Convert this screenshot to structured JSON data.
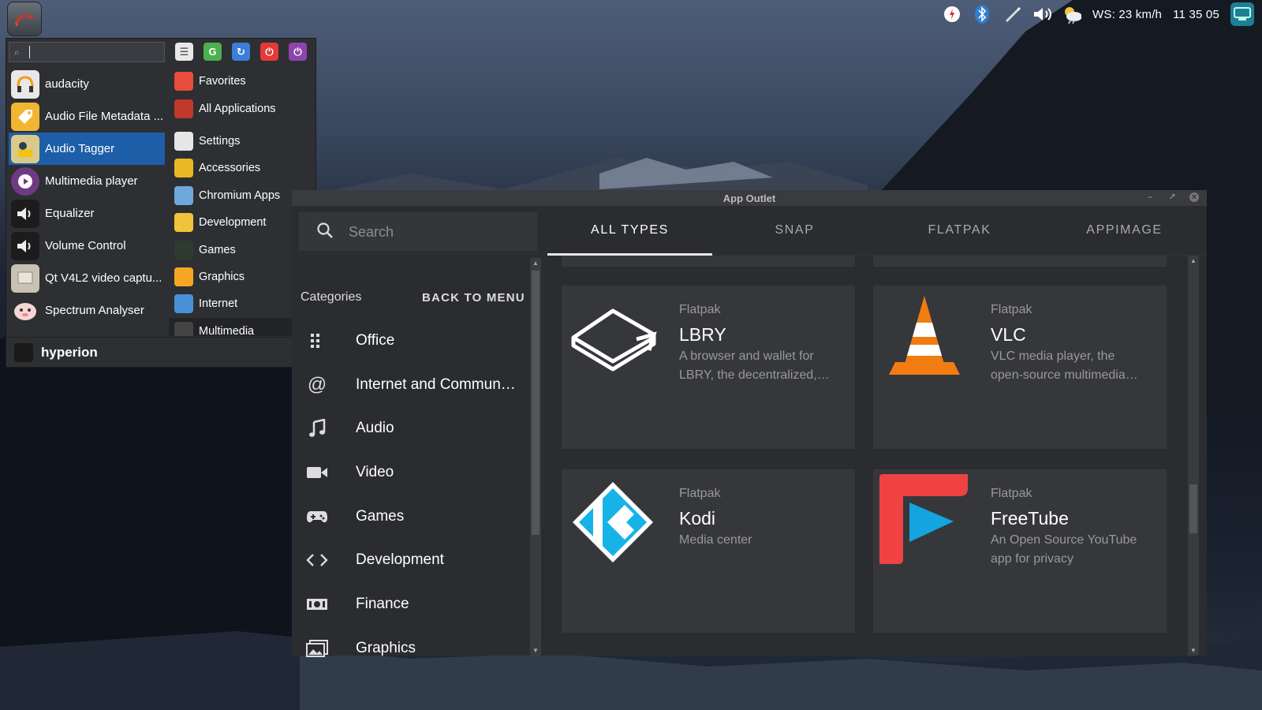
{
  "tray": {
    "weather_text": "WS: 23 km/h",
    "clock": "11 35 05"
  },
  "start_menu": {
    "search_value": "",
    "apps": [
      {
        "label": "audacity",
        "color": "#e8e8e8"
      },
      {
        "label": "Audio File Metadata ...",
        "color": "#f2b532"
      },
      {
        "label": "Audio Tagger",
        "color": "#d9c98a"
      },
      {
        "label": "Multimedia player",
        "color": "#6e3a82"
      },
      {
        "label": "Equalizer",
        "color": "#1c1c1c"
      },
      {
        "label": "Volume Control",
        "color": "#1c1c1c"
      },
      {
        "label": "Qt V4L2 video captu...",
        "color": "#c9c2b2"
      },
      {
        "label": "Spectrum Analyser",
        "color": "#f3c7c7"
      }
    ],
    "categories": [
      {
        "label": "Favorites",
        "color": "#e74c3c"
      },
      {
        "label": "All Applications",
        "color": "#c0392b"
      },
      {
        "label": "Settings",
        "color": "#e6e6e6"
      },
      {
        "label": "Accessories",
        "color": "#e9b824"
      },
      {
        "label": "Chromium Apps",
        "color": "#6fa8dc"
      },
      {
        "label": "Development",
        "color": "#f0c33c"
      },
      {
        "label": "Games",
        "color": "#2e3b2e"
      },
      {
        "label": "Graphics",
        "color": "#f5a623"
      },
      {
        "label": "Internet",
        "color": "#4a90d9"
      },
      {
        "label": "Multimedia",
        "color": "#444"
      }
    ],
    "user": "hyperion"
  },
  "window": {
    "title": "App Outlet",
    "search_placeholder": "Search",
    "categories_heading": "Categories",
    "back_to_menu": "BACK TO MENU",
    "categories": [
      {
        "label": "Office",
        "icon": "grid-icon"
      },
      {
        "label": "Internet and Commun…",
        "icon": "at-icon"
      },
      {
        "label": "Audio",
        "icon": "music-note-icon"
      },
      {
        "label": "Video",
        "icon": "video-camera-icon"
      },
      {
        "label": "Games",
        "icon": "gamepad-icon"
      },
      {
        "label": "Development",
        "icon": "code-icon"
      },
      {
        "label": "Finance",
        "icon": "money-icon"
      },
      {
        "label": "Graphics",
        "icon": "image-icon"
      }
    ],
    "tabs": [
      {
        "label": "ALL TYPES",
        "active": true
      },
      {
        "label": "SNAP",
        "active": false
      },
      {
        "label": "FLATPAK",
        "active": false
      },
      {
        "label": "APPIMAGE",
        "active": false
      }
    ],
    "cards": [
      {
        "type": "Flatpak",
        "name": "LBRY",
        "description": "A browser and wallet for LBRY, the decentralized,…",
        "logo": "lbry-logo"
      },
      {
        "type": "Flatpak",
        "name": "VLC",
        "description": "VLC media player, the open-source multimedia…",
        "logo": "vlc-logo"
      },
      {
        "type": "Flatpak",
        "name": "Kodi",
        "description": "Media center",
        "logo": "kodi-logo"
      },
      {
        "type": "Flatpak",
        "name": "FreeTube",
        "description": "An Open Source YouTube app for privacy",
        "logo": "freetube-logo"
      }
    ]
  }
}
